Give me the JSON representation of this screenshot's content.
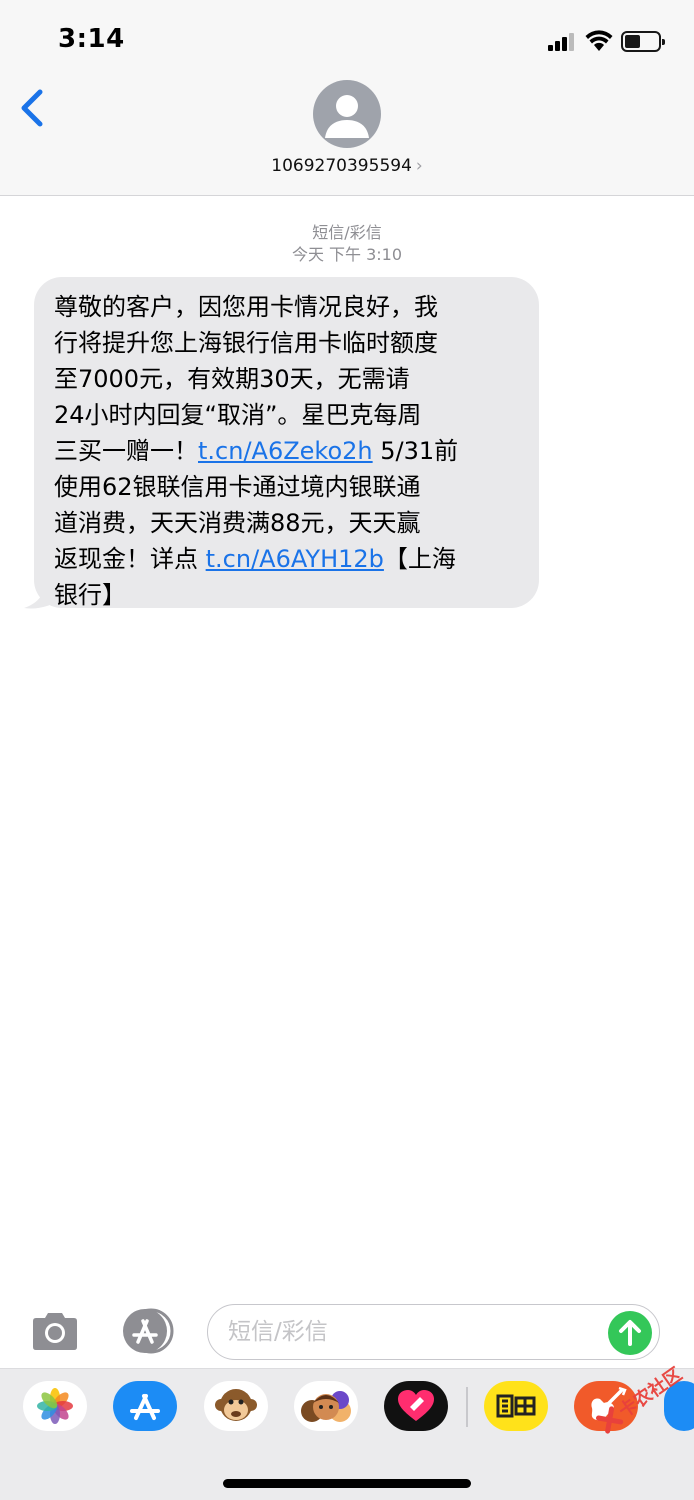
{
  "status_bar": {
    "time": "3:14"
  },
  "header": {
    "contact_number": "1069270395594",
    "back_icon": "chevron-left-icon"
  },
  "thread": {
    "message_type_label": "短信/彩信",
    "timestamp": "今天 下午 3:10",
    "message": {
      "line1": "尊敬的客户，因您用卡情况良好，我",
      "line2": "行将提升您上海银行信用卡临时额度",
      "line3": "至7000元，有效期30天，无需请",
      "line4": "24小时内回复“取消”。星巴克每周",
      "line5_pre": "三买一赠一！",
      "link1": "t.cn/A6Zeko2h",
      "line5_post": " 5/31前",
      "line6": "使用62银联信用卡通过境内银联通",
      "line7": "道消费，天天消费满88元，天天赢",
      "line8_pre": "返现金！详点 ",
      "link2": "t.cn/A6AYH12b",
      "line8_post": "【上海",
      "line9": "银行】"
    }
  },
  "compose": {
    "placeholder": "短信/彩信",
    "camera_icon": "camera-icon",
    "apps_icon": "app-store-icon",
    "send_icon": "send-arrow-icon"
  },
  "app_drawer": {
    "apps": [
      "photos-icon",
      "app-store-icon",
      "monkey-animoji-icon",
      "memoji-icon",
      "digital-touch-icon",
      "xianyu-icon",
      "garageband-icon",
      "partial-app-icon"
    ]
  },
  "watermark": {
    "text": "卡农社区"
  },
  "colors": {
    "link": "#1a73e8",
    "send": "#34c759",
    "bubble": "#e9e9eb",
    "back": "#1a73e8"
  }
}
